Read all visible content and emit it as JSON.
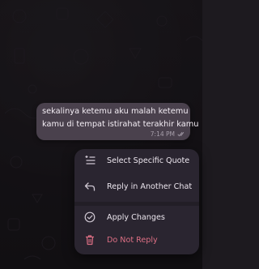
{
  "message": {
    "lines": [
      "sekalinya ketemu aku malah ketemu",
      "kamu di tempat istirahat terakhir kamu"
    ],
    "time": "7:14 PM",
    "status_icon": "double-check-icon"
  },
  "context_menu": {
    "items": [
      {
        "label": "Select Specific Quote",
        "icon": "select-quote-icon"
      },
      {
        "label": "Reply in Another Chat",
        "icon": "reply-another-chat-icon"
      },
      {
        "label": "Apply Changes",
        "icon": "check-circle-icon"
      },
      {
        "label": "Do Not Reply",
        "icon": "trash-icon"
      }
    ]
  },
  "colors": {
    "bubble": "#4a414d",
    "menu": "#2a2530",
    "danger": "#dc6f84",
    "text": "#ece6ee"
  }
}
